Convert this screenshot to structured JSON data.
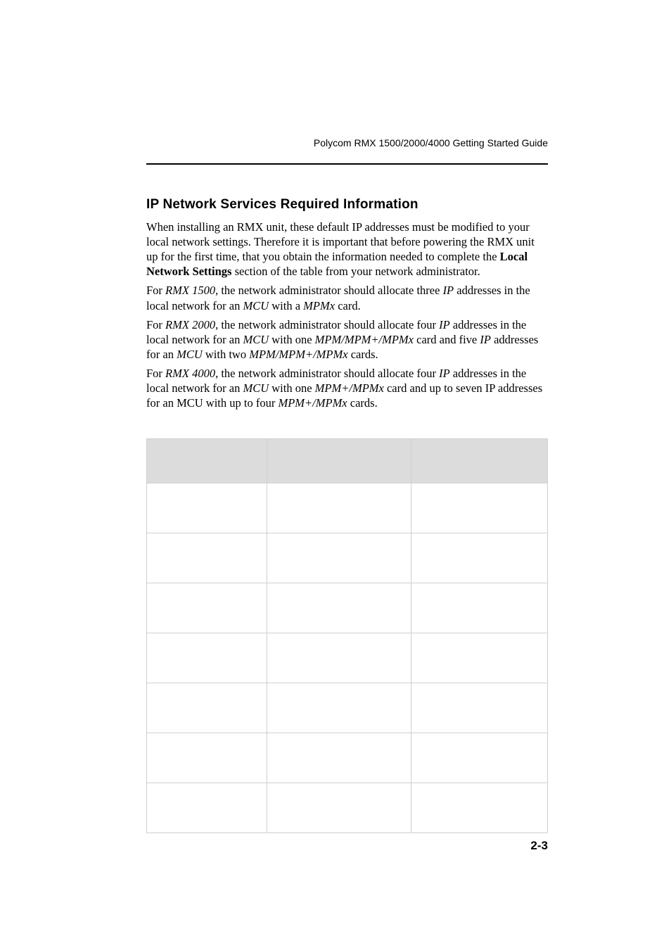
{
  "header": {
    "running_title": "Polycom RMX 1500/2000/4000 Getting Started Guide"
  },
  "section": {
    "heading": "IP Network Services Required Information",
    "paragraphs": {
      "p1_a": "When installing an RMX unit, these default IP addresses must be modified to your local network settings. Therefore it is important that before powering the RMX unit up for the first time, that you obtain the information needed to complete the ",
      "p1_b_strong": "Local Network Settings",
      "p1_c": " section of the table from your network administrator.",
      "p2_a": "For ",
      "p2_b_em": "RMX 1500",
      "p2_c": ", the network administrator should allocate three ",
      "p2_d_em": "IP",
      "p2_e": " addresses in the local network for an ",
      "p2_f_em": "MCU",
      "p2_g": " with a ",
      "p2_h_em": "MPMx",
      "p2_i": " card.",
      "p3_a": "For ",
      "p3_b_em": "RMX 2000",
      "p3_c": ", the network administrator should allocate four ",
      "p3_d_em": "IP",
      "p3_e": " addresses in the local network for an ",
      "p3_f_em": "MCU",
      "p3_g": " with one ",
      "p3_h_em": "MPM/MPM+/MPMx",
      "p3_i": " card and five ",
      "p3_j_em": "IP",
      "p3_k": " addresses for an ",
      "p3_l_em": "MCU",
      "p3_m": " with two ",
      "p3_n_em": "MPM/MPM+/MPMx",
      "p3_o": " cards.",
      "p4_a": "For ",
      "p4_b_em": "RMX 4000",
      "p4_c": ", the network administrator should allocate four ",
      "p4_d_em": "IP",
      "p4_e": " addresses in the local network for an ",
      "p4_f_em": "MCU",
      "p4_g": " with one ",
      "p4_h_em": "MPM+/MPMx",
      "p4_i": " card and up to seven IP addresses for an MCU with up to four ",
      "p4_j_em": "MPM+/MPMx",
      "p4_k": " cards."
    }
  },
  "table": {
    "headers": {
      "c1": "",
      "c2": "",
      "c3": ""
    },
    "rows": [
      {
        "c1": "",
        "c2": "",
        "c3": ""
      },
      {
        "c1": "",
        "c2": "",
        "c3": ""
      },
      {
        "c1": "",
        "c2": "",
        "c3": ""
      },
      {
        "c1": "",
        "c2": "",
        "c3": ""
      },
      {
        "c1": "",
        "c2": "",
        "c3": ""
      },
      {
        "c1": "",
        "c2": "",
        "c3": ""
      },
      {
        "c1": "",
        "c2": "",
        "c3": ""
      }
    ]
  },
  "footer": {
    "page_number": "2-3"
  }
}
